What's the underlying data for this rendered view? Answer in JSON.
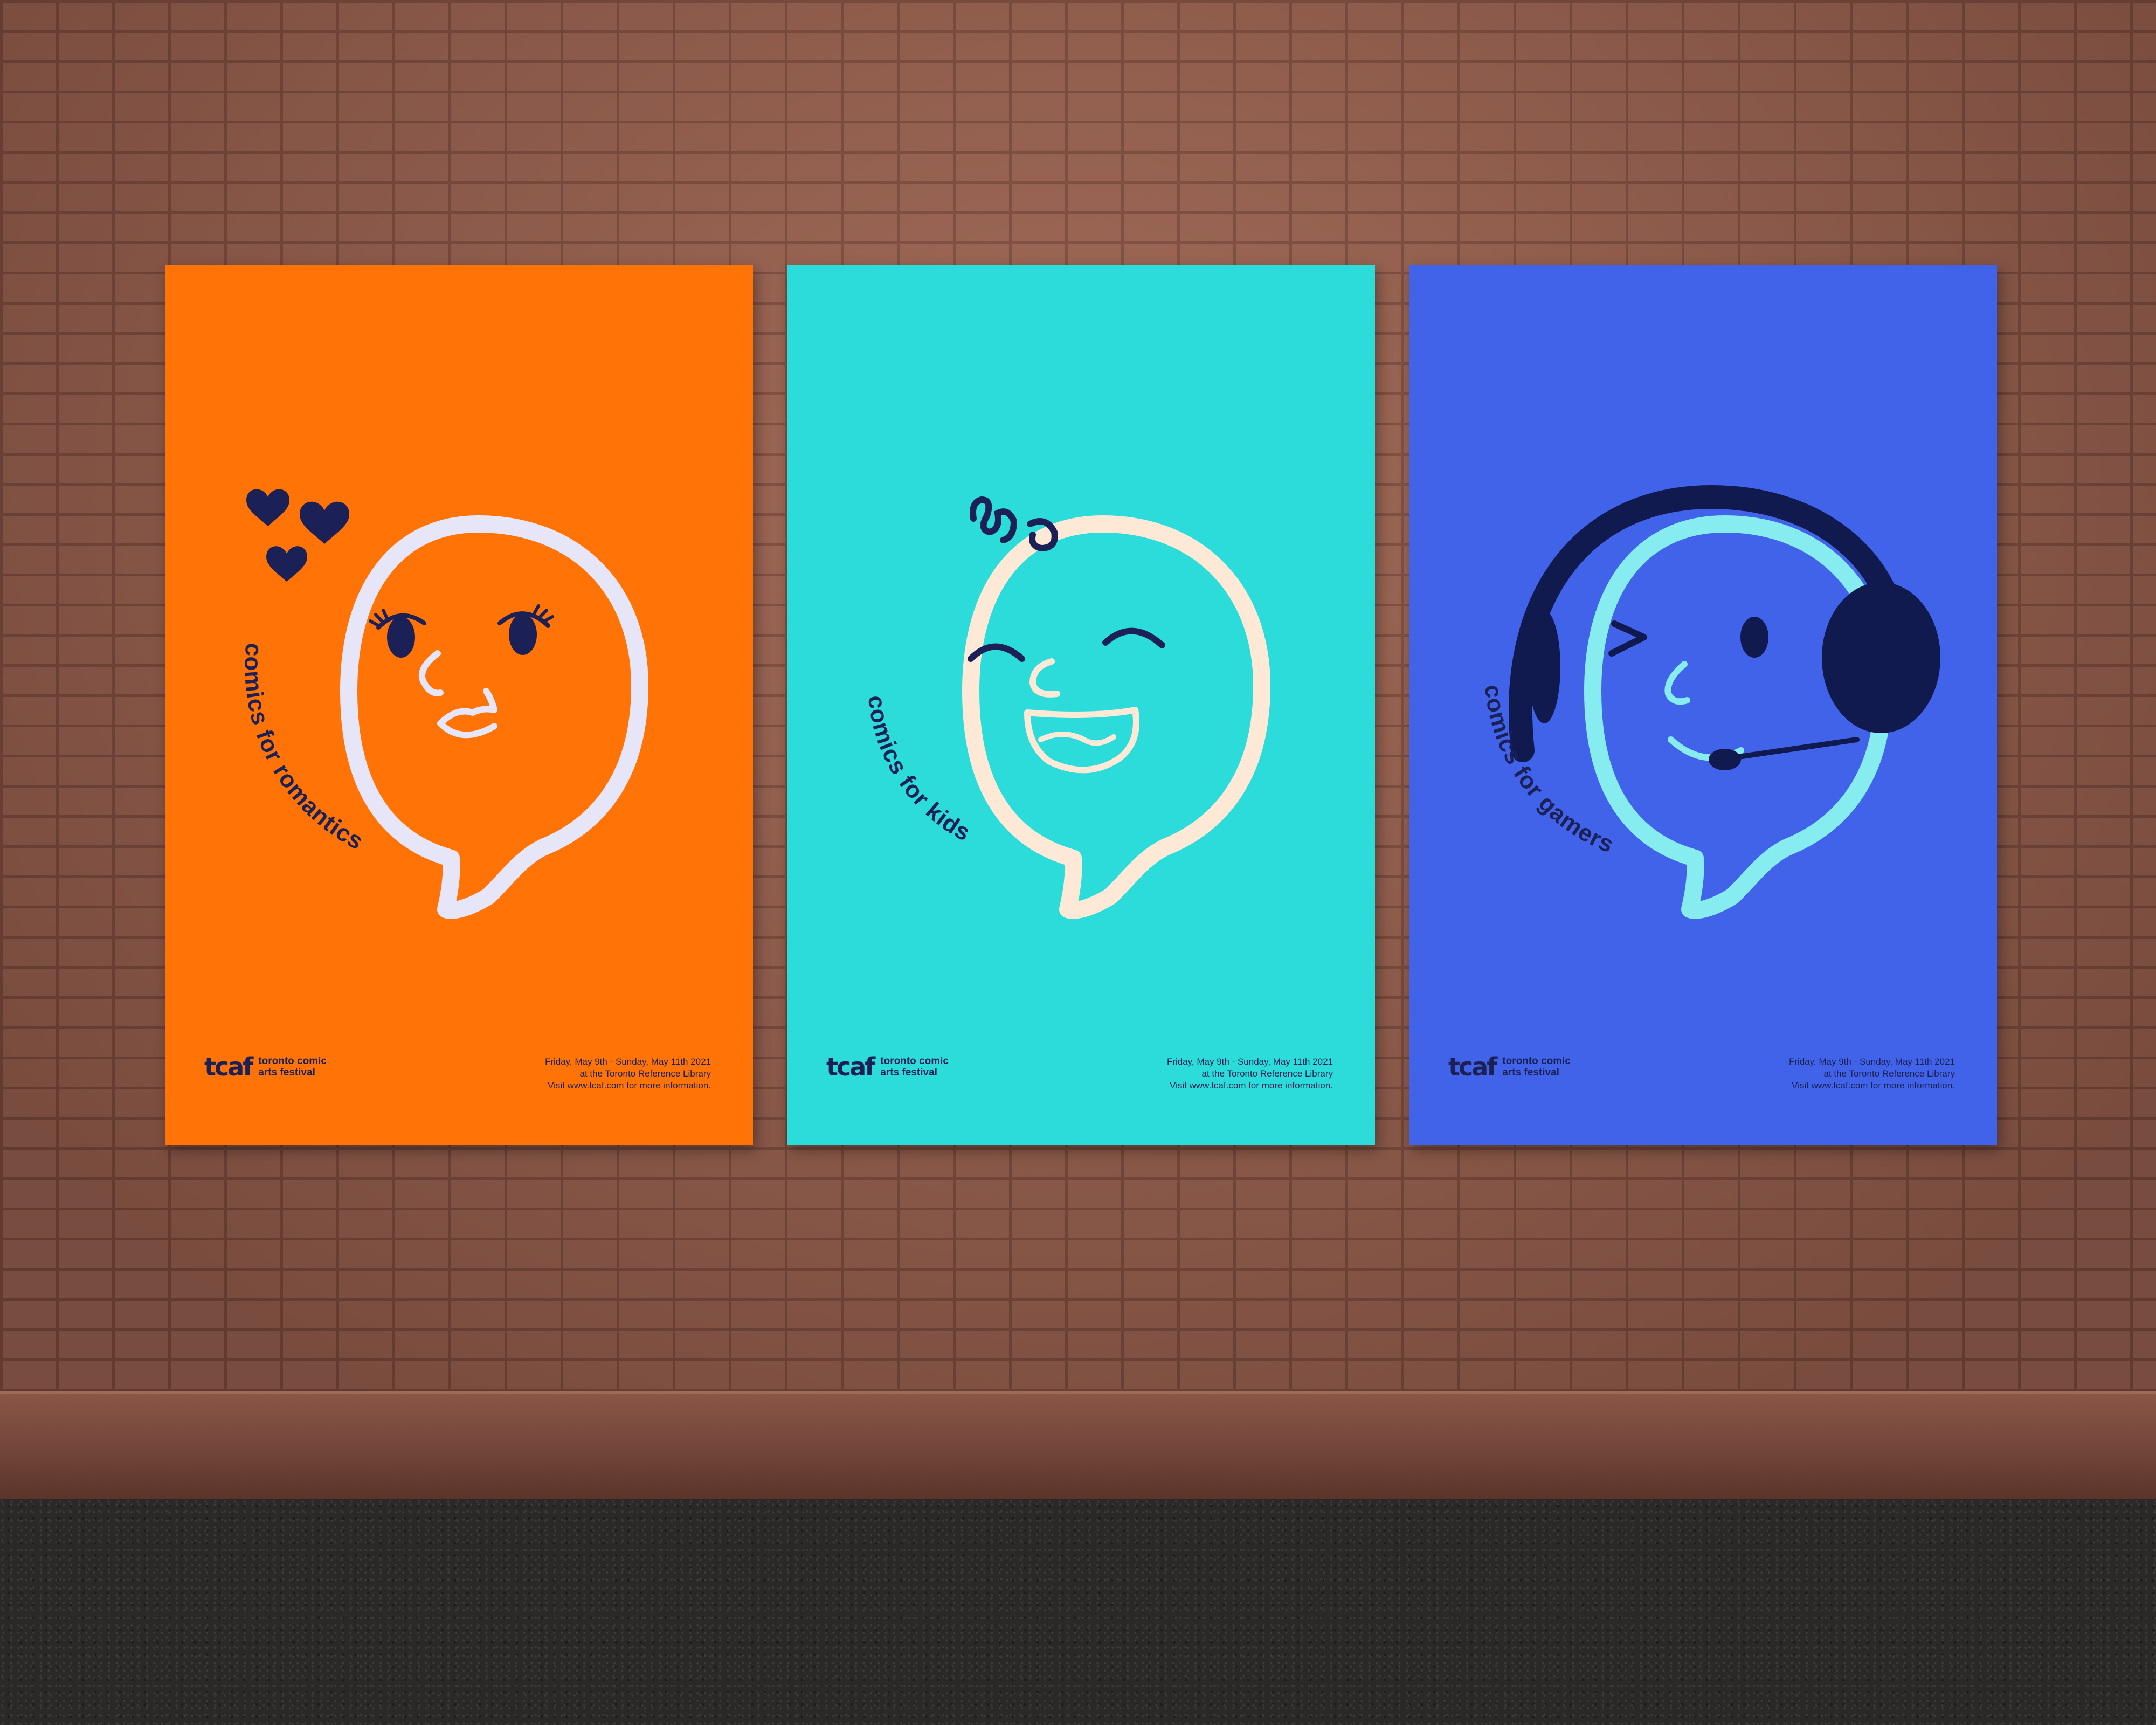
{
  "scene": {
    "wall_color": "#9b6452",
    "ground_color": "#2b2828"
  },
  "posters": [
    {
      "theme": "romantics",
      "background": "#ff7307",
      "bubble_color": "#e6e6f8",
      "tagline": "comics for romantics",
      "logo_mark": "tcaf",
      "logo_line1": "toronto comic",
      "logo_line2": "arts festival",
      "info_line1": "Friday, May 9th - Sunday, May 11th 2021",
      "info_line2": "at the Toronto Reference Library",
      "info_line3": "Visit www.tcaf.com for more information."
    },
    {
      "theme": "kids",
      "background": "#2cdcdb",
      "bubble_color": "#fde9d6",
      "tagline": "comics for kids",
      "logo_mark": "tcaf",
      "logo_line1": "toronto comic",
      "logo_line2": "arts festival",
      "info_line1": "Friday, May 9th - Sunday, May 11th 2021",
      "info_line2": "at the Toronto Reference Library",
      "info_line3": "Visit www.tcaf.com for more information."
    },
    {
      "theme": "gamers",
      "background": "#4163ea",
      "bubble_color": "#86ecef",
      "tagline": "comics for gamers",
      "logo_mark": "tcaf",
      "logo_line1": "toronto comic",
      "logo_line2": "arts festival",
      "info_line1": "Friday, May 9th - Sunday, May 11th 2021",
      "info_line2": "at the Toronto Reference Library",
      "info_line3": "Visit www.tcaf.com for more information."
    }
  ]
}
